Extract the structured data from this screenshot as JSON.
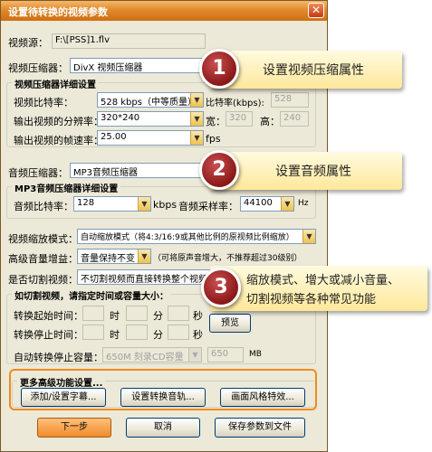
{
  "window": {
    "title": "设置待转换的视频参数",
    "close_glyph": "✕"
  },
  "video_source": {
    "label": "视频源：",
    "value": "F:\\[PSS]1.flv"
  },
  "video_codec": {
    "label": "视频压缩器：",
    "value": "DivX 视频压缩器"
  },
  "video_detail": {
    "title": "视频压缩器详细设置",
    "bitrate_label": "视频比特率：",
    "bitrate_value": "528   kbps（中等质量）",
    "bitrate_kbps_label": "比特率(kbps):",
    "bitrate_kbps_value": "528",
    "resolution_label": "输出视频的分辨率：",
    "resolution_value": "320*240",
    "width_label": "宽：",
    "width_value": "320",
    "height_label": "高：",
    "height_value": "240",
    "framerate_label": "输出视频的帧速率：",
    "framerate_value": "25.00",
    "fps_label": "fps"
  },
  "audio_codec": {
    "label": "音频压缩器：",
    "value": "MP3音频压缩器"
  },
  "audio_detail": {
    "title": "MP3音频压缩器详细设置",
    "bitrate_label": "音频比特率：",
    "bitrate_value": "128",
    "kbps_label": "kbps",
    "samplerate_label": "音频采样率：",
    "samplerate_value": "44100",
    "hz_label": "Hz"
  },
  "scale_mode": {
    "label": "视频缩放模式：",
    "value": "自动缩放模式（将4:3/16:9或其他比例的原视频比例缩放）"
  },
  "volume": {
    "label": "高级音量增益：",
    "value": "音量保持不变",
    "hint": "（可将原声音增大，不推荐超过30级别）"
  },
  "cut": {
    "label": "是否切割视频：",
    "value": "不切割视频而直接转换整个视频"
  },
  "cut_detail": {
    "title": "如切割视频，请指定时间或容量大小：",
    "start_label": "转换起始时间：",
    "stop_label": "转换停止时间：",
    "hour": "时",
    "minute": "分",
    "second": "秒",
    "preview_label": "预览",
    "capacity_label": "自动转换停止容量：",
    "capacity_value": "650M 刻录CD容量",
    "capacity_mb_value": "650",
    "mb_label": "MB"
  },
  "advanced": {
    "title": "更多高级功能设置...",
    "subtitle_btn": "添加/设置字幕...",
    "audio_track_btn": "设置转换音轨...",
    "style_btn": "画面风格特效..."
  },
  "footer": {
    "next_btn": "下一步",
    "cancel_btn": "取消",
    "save_btn": "保存参数到文件"
  },
  "callouts": [
    {
      "num": "1",
      "text": "设置视频压缩属性"
    },
    {
      "num": "2",
      "text": "设置音频属性"
    },
    {
      "num": "3",
      "line1": "缩放模式、增大或减小音量、",
      "line2": "切割视频等各种常见功能"
    }
  ],
  "colors": {
    "accent": "#f08a1c",
    "badge": "#8a1818",
    "callout_bg": "#ffe89a"
  },
  "icons": {
    "dropdown": "▼"
  }
}
